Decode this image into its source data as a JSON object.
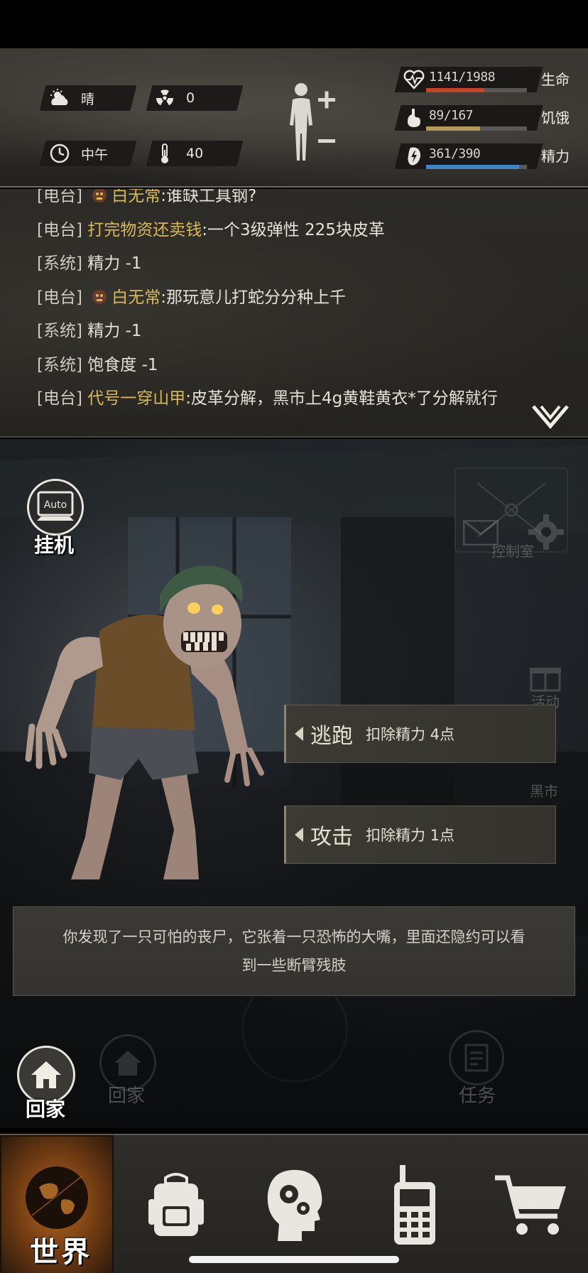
{
  "status": {
    "weather": {
      "icon": "sun-cloud-icon",
      "label": "晴"
    },
    "radiation": {
      "icon": "radiation-icon",
      "value": "0"
    },
    "time": {
      "icon": "clock-icon",
      "label": "中午"
    },
    "temperature": {
      "icon": "thermometer-icon",
      "value": "40"
    },
    "body_icon": "body-figure-icon",
    "stats": [
      {
        "icon": "heart-pulse-icon",
        "value": "1141/1988",
        "name": "生命",
        "fraction": 0.574,
        "color": "#c4432b"
      },
      {
        "icon": "stomach-icon",
        "value": "89/167",
        "name": "饥饿",
        "fraction": 0.533,
        "color": "#b39a5a"
      },
      {
        "icon": "energy-bolt-icon",
        "value": "361/390",
        "name": "精力",
        "fraction": 0.926,
        "color": "#3f86c7"
      }
    ]
  },
  "chat": {
    "lines": [
      {
        "tag": "[电台]",
        "who": "白无常",
        "msg": ":谁缺工具钢?",
        "avatar": true
      },
      {
        "tag": "[电台]",
        "who": "打完物资还卖钱",
        "msg": ":一个3级弹性 225块皮革",
        "avatar": false
      },
      {
        "tag": "[系统]",
        "who": "",
        "msg": "精力 -1",
        "avatar": false
      },
      {
        "tag": "[电台]",
        "who": "白无常",
        "msg": ":那玩意儿打蛇分分种上千",
        "avatar": true
      },
      {
        "tag": "[系统]",
        "who": "",
        "msg": "精力 -1",
        "avatar": false
      },
      {
        "tag": "[系统]",
        "who": "",
        "msg": "饱食度 -1",
        "avatar": false
      },
      {
        "tag": "[电台]",
        "who": "代号一穿山甲",
        "msg": ":皮革分解，黑市上4g黄鞋黄衣*了分解就行",
        "avatar": false
      }
    ]
  },
  "scene": {
    "auto_label": "挂机",
    "auto_icon_text": "Auto",
    "faded": {
      "control_room": "控制室",
      "activity": "活动",
      "black_market": "黑市",
      "home": "回家",
      "task": "任务"
    },
    "actions": [
      {
        "name": "逃跑",
        "cost": "扣除精力 4点"
      },
      {
        "name": "攻击",
        "cost": "扣除精力 1点"
      }
    ],
    "description": "你发现了一只可怕的丧尸，它张着一只恐怖的大嘴，里面还隐约可以看到一些断臂残肢",
    "home_label": "回家"
  },
  "nav": {
    "items": [
      {
        "icon": "globe-icon",
        "label": "世界",
        "active": true
      },
      {
        "icon": "backpack-icon",
        "label": "",
        "active": false
      },
      {
        "icon": "head-gears-icon",
        "label": "",
        "active": false
      },
      {
        "icon": "walkie-talkie-icon",
        "label": "",
        "active": false
      },
      {
        "icon": "shopping-cart-icon",
        "label": "",
        "active": false
      }
    ]
  }
}
